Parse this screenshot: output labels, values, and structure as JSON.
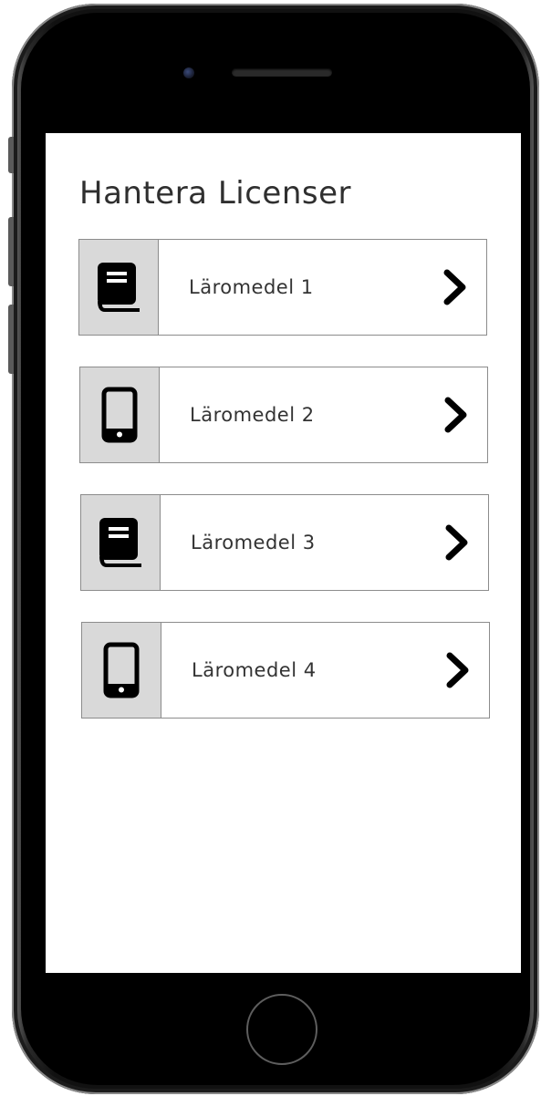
{
  "screen": {
    "title": "Hantera Licenser"
  },
  "items": [
    {
      "label": "Läromedel 1",
      "icon": "book-icon"
    },
    {
      "label": "Läromedel 2",
      "icon": "smartphone-icon"
    },
    {
      "label": "Läromedel 3",
      "icon": "book-icon"
    },
    {
      "label": "Läromedel 4",
      "icon": "smartphone-icon"
    }
  ],
  "colors": {
    "thumb_background": "#d9d9d9",
    "border": "#8c8c8c",
    "title_text": "#2f2f2f",
    "icon": "#000000"
  }
}
